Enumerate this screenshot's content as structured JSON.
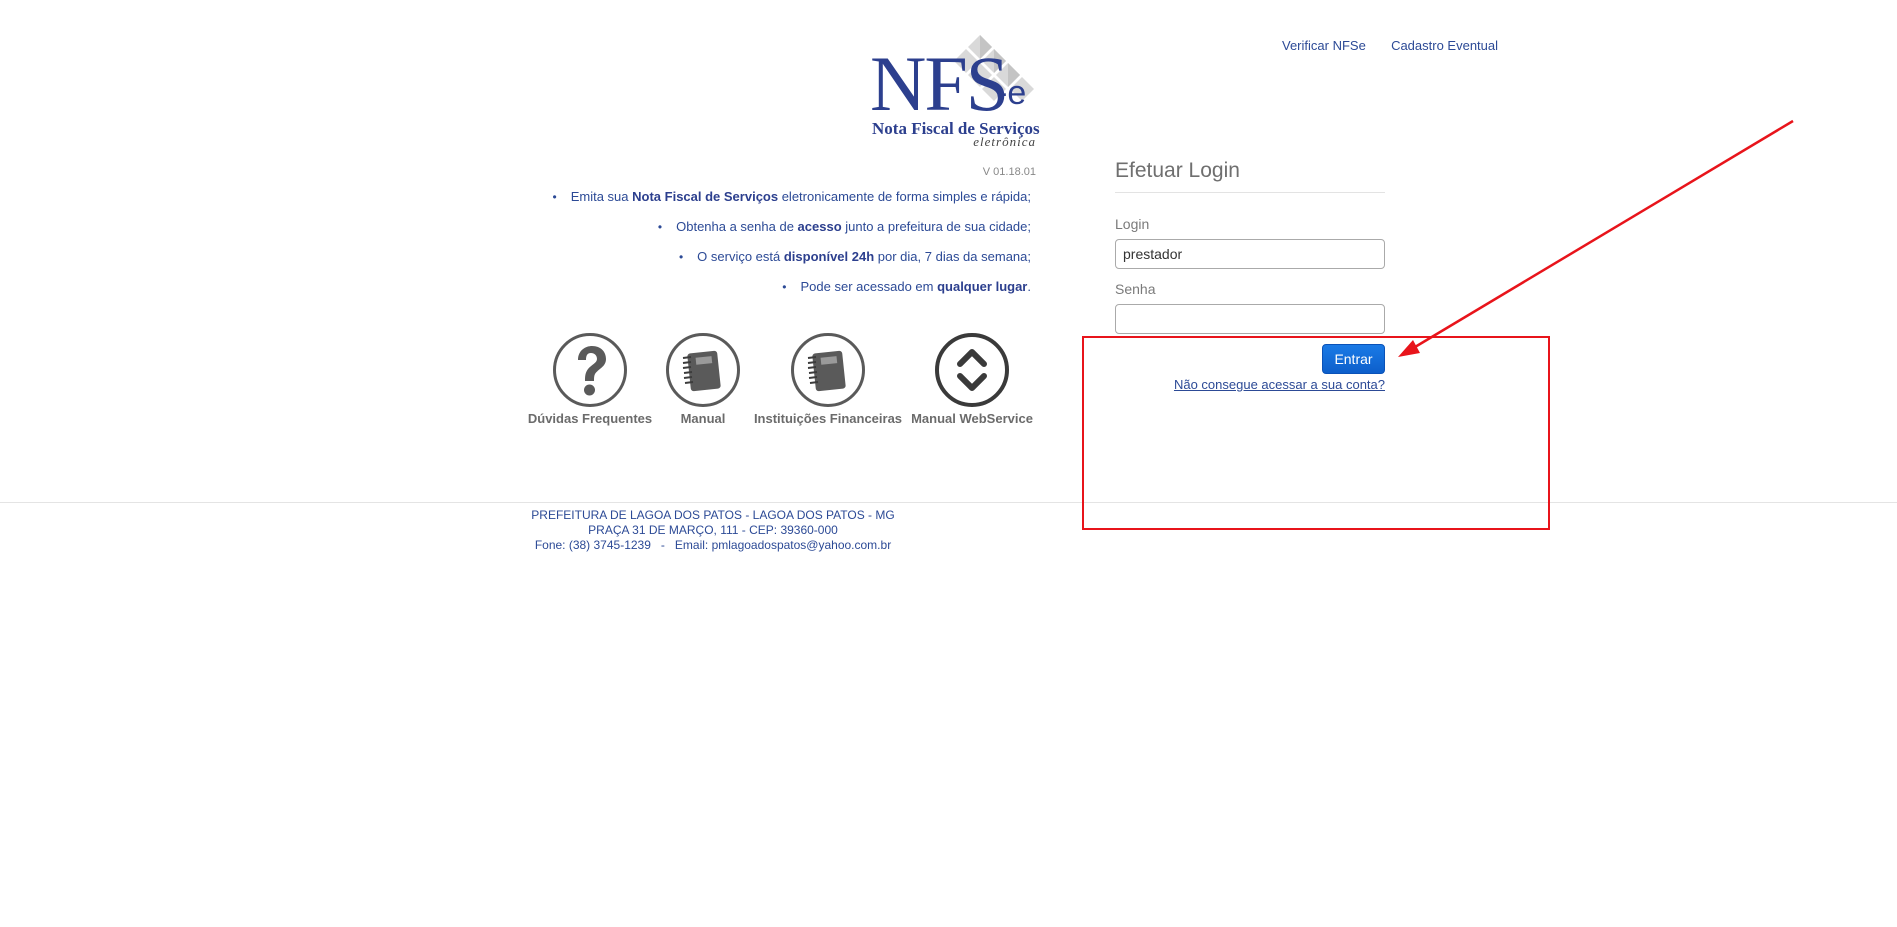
{
  "header": {
    "links": [
      "Verificar NFSe",
      "Cadastro Eventual"
    ]
  },
  "logo": {
    "main": "NFS",
    "suffix": "-e",
    "subtitle": "Nota Fiscal de Serviços",
    "subtitle2": "eletrônica"
  },
  "version": "V 01.18.01",
  "features": [
    {
      "pre": "Emita sua ",
      "bold": "Nota Fiscal de Serviços",
      "post": " eletronicamente de forma simples e rápida;"
    },
    {
      "pre": "Obtenha a senha de ",
      "bold": "acesso",
      "post": " junto a prefeitura de sua cidade;"
    },
    {
      "pre": "O serviço está ",
      "bold": "disponível 24h",
      "post": " por dia, 7 dias da semana;"
    },
    {
      "pre": "Pode ser acessado em ",
      "bold": "qualquer lugar",
      "post": "."
    }
  ],
  "shortcuts": [
    {
      "label": "Dúvidas Frequentes",
      "icon": "question-icon"
    },
    {
      "label": "Manual",
      "icon": "notebook-icon"
    },
    {
      "label": "Instituições Financeiras",
      "icon": "notebook-icon"
    },
    {
      "label": "Manual WebService",
      "icon": "up-down-chevron-icon"
    }
  ],
  "login": {
    "title": "Efetuar Login",
    "login_label": "Login",
    "login_value": "prestador",
    "password_label": "Senha",
    "password_value": "",
    "submit_label": "Entrar",
    "forgot_label": "Não consegue acessar a sua conta?"
  },
  "footer": {
    "line1": "PREFEITURA DE LAGOA DOS PATOS - LAGOA DOS PATOS - MG",
    "line2": "PRAÇA 31 DE MARÇO, 111 - CEP: 39360-000",
    "line3": "Fone: (38) 3745-1239   -   Email: pmlagoadospatos@yahoo.com.br"
  },
  "colors": {
    "link": "#2c4a96",
    "brand": "#2c3f8e",
    "button": "#1a7ae6",
    "annotation": "#e8141b"
  }
}
